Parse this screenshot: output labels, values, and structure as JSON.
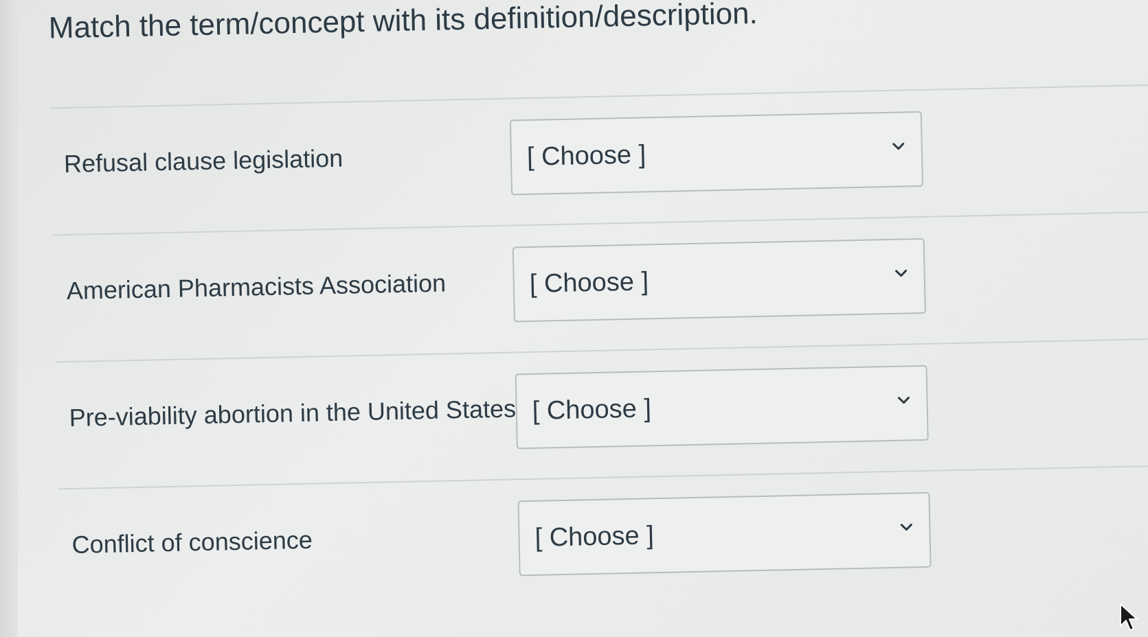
{
  "question": {
    "title": "Match the term/concept with its definition/description."
  },
  "rows": [
    {
      "term": "Refusal clause legislation",
      "selected": "[ Choose ]"
    },
    {
      "term": "American Pharmacists Association",
      "selected": "[ Choose ]"
    },
    {
      "term": "Pre-viability abortion in the United States",
      "selected": "[ Choose ]"
    },
    {
      "term": "Conflict of conscience",
      "selected": "[ Choose ]"
    }
  ],
  "icons": {
    "dropdown": "chevron-down-icon",
    "cursor": "mouse-cursor-icon"
  },
  "colors": {
    "text": "#2d3b45",
    "background": "#e9ebea",
    "select_border": "#b7bdbc",
    "divider": "#cfd3d2"
  }
}
